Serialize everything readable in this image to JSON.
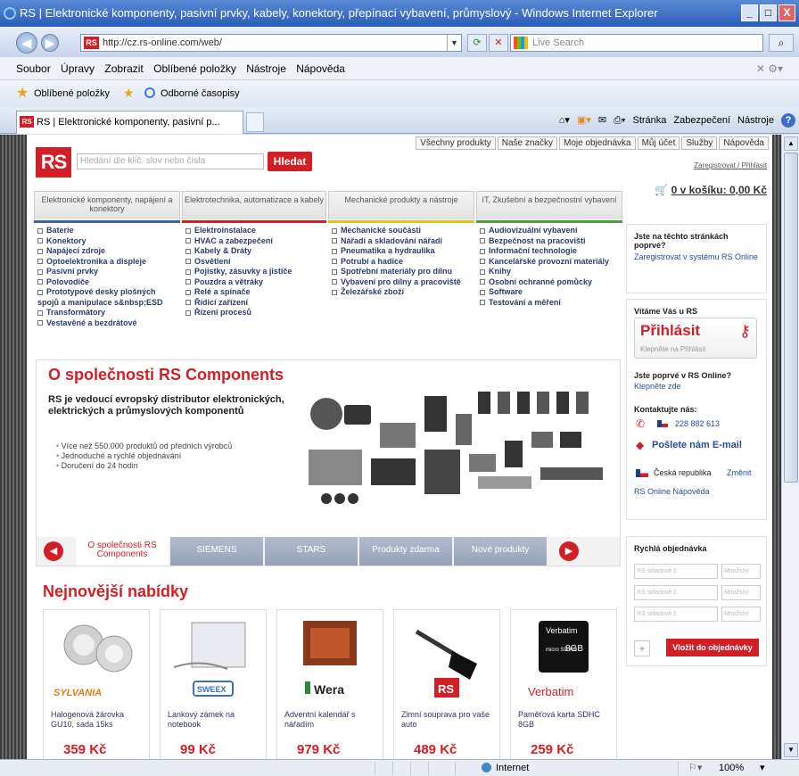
{
  "window": {
    "title": "RS | Elektronické komponenty, pasivní prvky, kabely, konektory, přepínací vybavení, průmyslový - Windows Internet Explorer",
    "min": "_",
    "max": "□",
    "close": "X"
  },
  "address": {
    "url": "http://cz.rs-online.com/web/",
    "rs": "RS",
    "search_placeholder": "Live Search"
  },
  "menu": [
    "Soubor",
    "Úpravy",
    "Zobrazit",
    "Oblíbené položky",
    "Nástroje",
    "Nápověda"
  ],
  "favorites": {
    "label": "Oblíbené položky",
    "link": "Odborné časopisy"
  },
  "tab": {
    "label": "RS | Elektronické komponenty, pasivní p..."
  },
  "commandbar": {
    "page": "Stránka",
    "security": "Zabezpečení",
    "tools": "Nástroje"
  },
  "site": {
    "toplinks": [
      "Všechny produkty",
      "Naše značky",
      "Moje objednávka",
      "Můj účet",
      "Služby",
      "Nápověda"
    ],
    "logo": "RS",
    "search_placeholder": "Hledání dle klíč. slov nebo čísla",
    "search_button": "Hledat",
    "register": "Zaregistrovat / Přihlásit",
    "cart": "0  v košíku: 0,00 Kč",
    "categories": [
      {
        "label": "Elektronické komponenty, napájení a konektory",
        "color": "#3b63b3",
        "items": [
          "Baterie",
          "Konektory",
          "Napájecí zdroje",
          "Optoelektronika a displeje",
          "Pasivní prvky",
          "Polovodiče",
          "Prototypové desky plošných spojů a manipulace s&nbsp;ESD",
          "Transformátory",
          "Vestavěné a bezdrátové"
        ]
      },
      {
        "label": "Elektrotechnika, automatizace a kabely",
        "color": "#d21f26",
        "items": [
          "Elektroinstalace",
          "HVAC a zabezpečení",
          "Kabely & Dráty",
          "Osvětlení",
          "Pojistky, zásuvky a jističe",
          "Pouzdra a větráky",
          "Relé a spínače",
          "Řídicí zařízení",
          "Řízení procesů"
        ]
      },
      {
        "label": "Mechanické produkty a nástroje",
        "color": "#e6c21c",
        "items": [
          "Mechanické součásti",
          "Nářadí a skladování nářadí",
          "Pneumatika a hydraulika",
          "Potrubí a hadice",
          "Spotřební materiály pro dílnu",
          "Vybavení pro dílny a pracoviště",
          "Železářské zboží"
        ]
      },
      {
        "label": "IT, Zkušební a bezpečnostní vybavení",
        "color": "#4aa33a",
        "items": [
          "Audiovizuální vybavení",
          "Bezpečnost na pracovišti",
          "Informační technologie",
          "Kancelářské provozní materiály",
          "Knihy",
          "Osobní ochranné pomůcky",
          "Software",
          "Testování a měření"
        ]
      }
    ],
    "hero": {
      "title": "O společnosti RS Components",
      "lead": "RS je vedoucí evropský distributor elektronických, elektrických a průmyslových komponentů",
      "bullets": [
        "Více než 550.000 produktů od předních výrobců",
        "Jednoduché a rychlé objednávání",
        "Doručení do 24 hodin"
      ],
      "tabs": [
        "O společnosti RS Components",
        "SIEMENS",
        "STARS",
        "Produkty zdarma",
        "Nové produkty"
      ]
    },
    "deals_title": "Nejnovější nabídky",
    "products": [
      {
        "brand": "SYLVANIA",
        "name": "Halogenová žárovka GU10, sada 15ks",
        "price": "359 Kč"
      },
      {
        "brand": "SWEEX",
        "name": "Lankový zámek na notebook",
        "price": "99 Kč"
      },
      {
        "brand": "Wera",
        "name": "Adventní kalendář s nářadím",
        "price": "979 Kč"
      },
      {
        "brand": "RS",
        "name": "Zimní souprava pro vaše auto",
        "price": "489 Kč"
      },
      {
        "brand": "Verbatim",
        "name": "Paměťová karta SDHC 8GB",
        "price": "259 Kč",
        "card_brand": "Verbatim",
        "card_size": "8GB",
        "card_type": "micro SD HC"
      }
    ],
    "sidebar": {
      "first_time_q": "Jste na těchto stránkách poprvé?",
      "register_link": "Zaregistrovat v systému RS Online",
      "welcome": "Vítáme Vás u RS",
      "login": "Přihlásit",
      "login_hint": "Klepněte na Přihlásit",
      "new_q": "Jste poprvé v RS Online?",
      "click_here": "Klepněte zde",
      "contact": "Kontaktujte nás:",
      "phone": "228 882 613",
      "email": "Pošlete nám E-mail",
      "country": "Česká republika",
      "change": "Změnit",
      "help": "RS Online Nápověda",
      "quick_title": "Rychlá objednávka",
      "quick_stock": [
        "RS skladové č.",
        "RS skladové č.",
        "RS skladové č."
      ],
      "quick_qty": [
        "Množství",
        "Množství",
        "Množství"
      ],
      "quick_add": "Vložit do objednávky"
    }
  },
  "status": {
    "zone": "Internet",
    "zoom": "100%"
  }
}
